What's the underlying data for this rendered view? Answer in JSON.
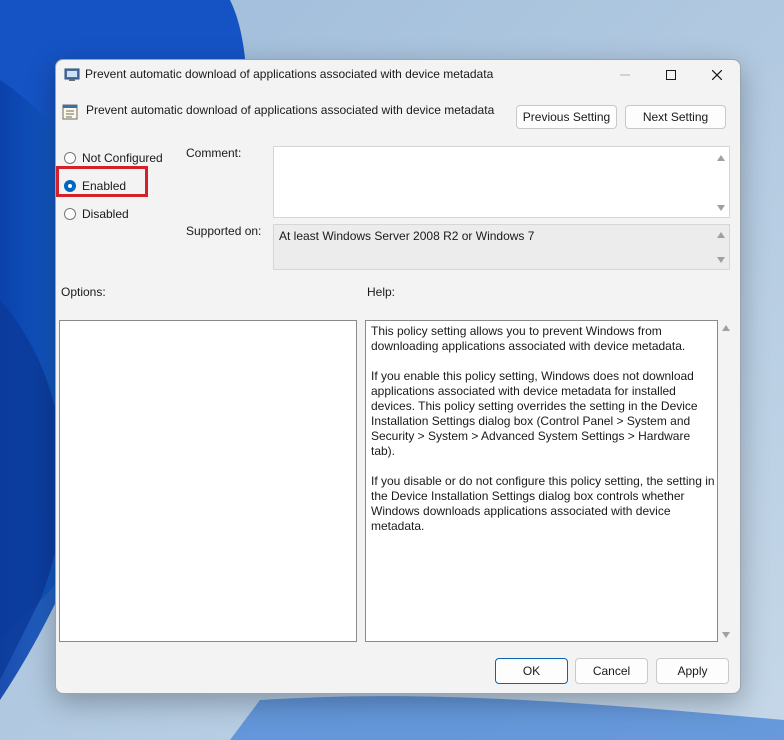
{
  "window": {
    "title": "Prevent automatic download of applications associated with device metadata"
  },
  "header": {
    "policy_name": "Prevent automatic download of applications associated with device metadata",
    "previous_setting_label": "Previous Setting",
    "next_setting_label": "Next Setting"
  },
  "state": {
    "options": [
      {
        "label": "Not Configured",
        "selected": false
      },
      {
        "label": "Enabled",
        "selected": true
      },
      {
        "label": "Disabled",
        "selected": false
      }
    ]
  },
  "comment": {
    "label": "Comment:",
    "value": ""
  },
  "supported_on": {
    "label": "Supported on:",
    "value": "At least Windows Server 2008 R2 or Windows 7"
  },
  "options_section": {
    "label": "Options:"
  },
  "help_section": {
    "label": "Help:",
    "paragraphs": [
      "This policy setting allows you to prevent Windows from downloading applications associated with device metadata.",
      "If you enable this policy setting, Windows does not download applications associated with device metadata for installed devices. This policy setting overrides the setting in the Device Installation Settings dialog box (Control Panel > System and Security > System > Advanced System Settings > Hardware tab).",
      "If you disable or do not configure this policy setting, the setting in the Device Installation Settings dialog box controls whether Windows downloads applications associated with device metadata."
    ]
  },
  "footer": {
    "ok_label": "OK",
    "cancel_label": "Cancel",
    "apply_label": "Apply"
  },
  "colors": {
    "accent": "#0067c0",
    "highlight": "#d32029"
  }
}
